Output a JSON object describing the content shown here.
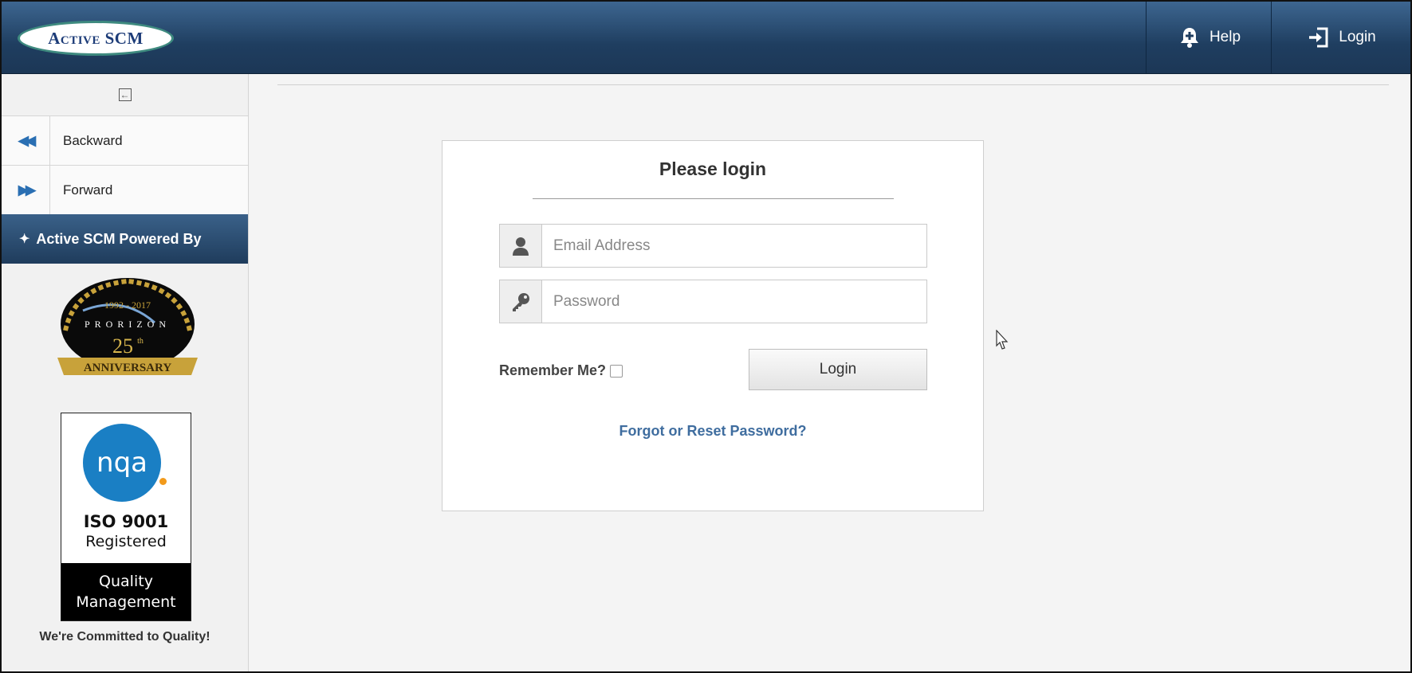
{
  "header": {
    "logo_text": "Active SCM",
    "help_label": "Help",
    "login_label": "Login",
    "help_icon": "bell-plus-icon",
    "login_icon": "sign-in-icon"
  },
  "sidebar": {
    "collapse_icon": "collapse-sidebar-icon",
    "items": [
      {
        "label": "Backward",
        "icon": "double-chevron-left-icon"
      },
      {
        "label": "Forward",
        "icon": "double-chevron-right-icon"
      }
    ],
    "powered_by": "Active SCM Powered By",
    "anniversary_badge": {
      "years": "1992 - 2017",
      "company": "PRORIZON",
      "number": "25",
      "ordinal": "th",
      "ribbon": "ANNIVERSARY"
    },
    "iso_badge": {
      "brand": "nqa",
      "title": "ISO 9001",
      "subtitle": "Registered",
      "footer_line1": "Quality",
      "footer_line2": "Management"
    },
    "tagline": "We're Committed to Quality!"
  },
  "login_panel": {
    "title": "Please login",
    "email_placeholder": "Email Address",
    "email_value": "",
    "password_placeholder": "Password",
    "password_value": "",
    "remember_label": "Remember Me?",
    "remember_checked": false,
    "login_button": "Login",
    "forgot_link": "Forgot or Reset Password?"
  },
  "colors": {
    "header": "#1f3e60",
    "accent_blue": "#2a6fb3",
    "link": "#3f6d9f",
    "nqa_blue": "#1a7fc4",
    "nqa_orange": "#f29a1b"
  }
}
